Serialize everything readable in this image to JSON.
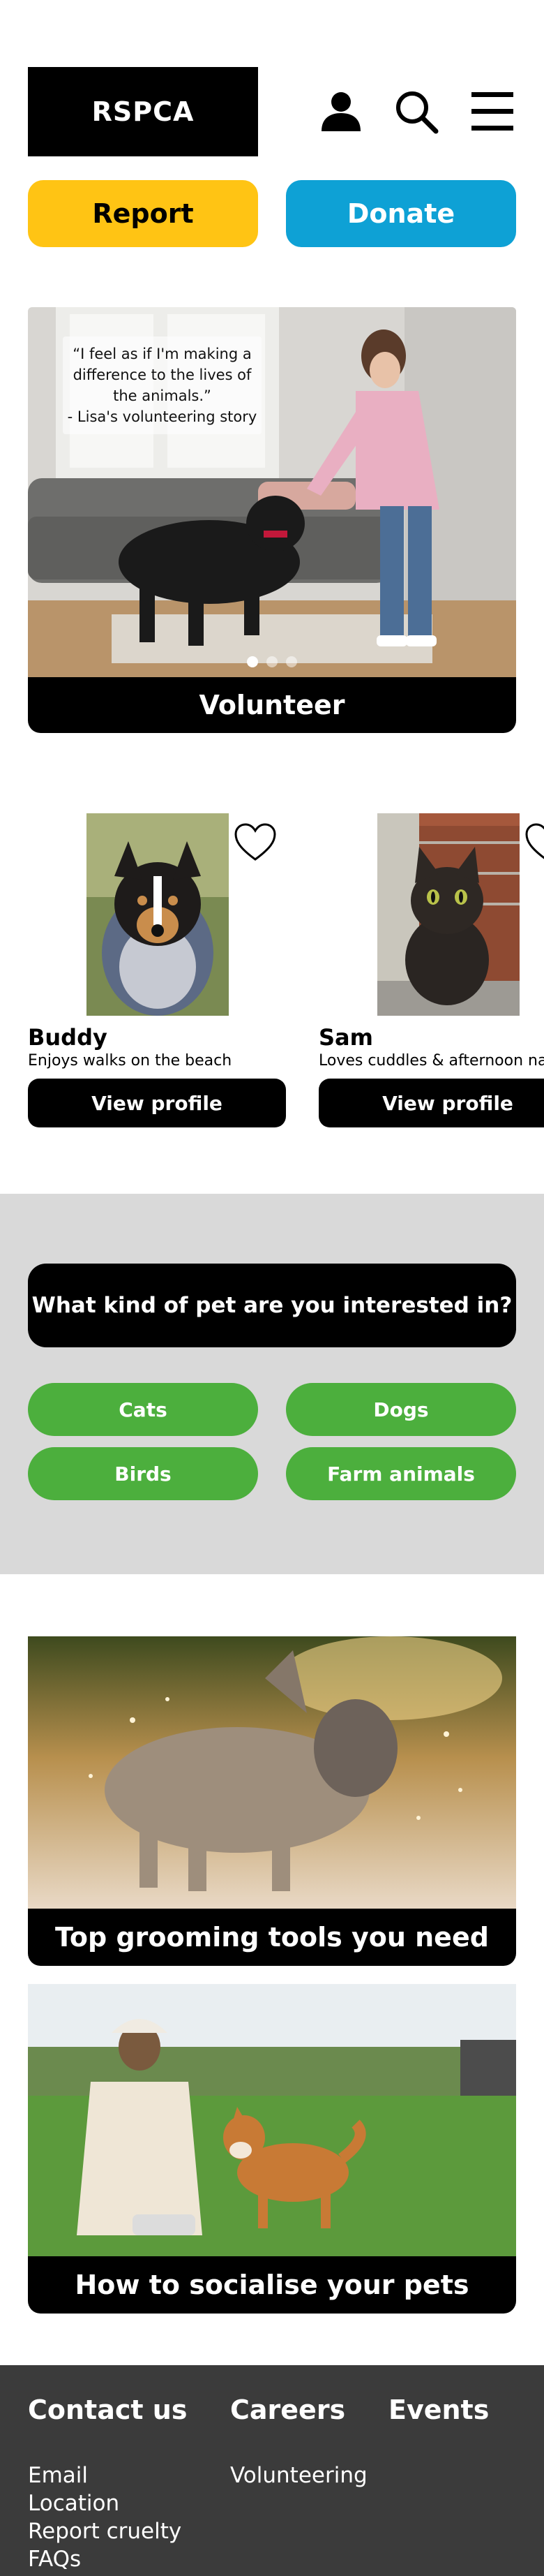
{
  "header": {
    "logo_text": "RSPCA",
    "icons": [
      "user-icon",
      "search-icon",
      "menu-icon"
    ]
  },
  "actions": {
    "report_label": "Report",
    "donate_label": "Donate"
  },
  "hero": {
    "quote": "“I feel as if I'm making a difference to the lives of the animals.”\n- Lisa's volunteering story",
    "caption": "Volunteer",
    "slide_count": 3,
    "active_slide": 1
  },
  "pets": [
    {
      "name": "Buddy",
      "description": "Enjoys walks on the beach",
      "button": "View profile"
    },
    {
      "name": "Sam",
      "description": "Loves cuddles & afternoon na",
      "button": "View profile"
    }
  ],
  "interest": {
    "question": "What kind of pet are you interested in?",
    "options": [
      "Cats",
      "Dogs",
      "Birds",
      "Farm animals"
    ]
  },
  "articles": [
    {
      "title": "Top grooming tools you need"
    },
    {
      "title": "How to socialise your pets"
    }
  ],
  "footer": {
    "contact": {
      "heading": "Contact us",
      "links": [
        "Email",
        "Location",
        "Report cruelty",
        "FAQs"
      ]
    },
    "careers": {
      "heading": "Careers",
      "links": [
        "Volunteering"
      ]
    },
    "events": {
      "heading": "Events"
    }
  },
  "colors": {
    "report": "#FFC414",
    "donate": "#0EA1D5",
    "chip": "#4CAF3D",
    "band": "#D9D9D9",
    "footer": "#3B3B3B"
  }
}
